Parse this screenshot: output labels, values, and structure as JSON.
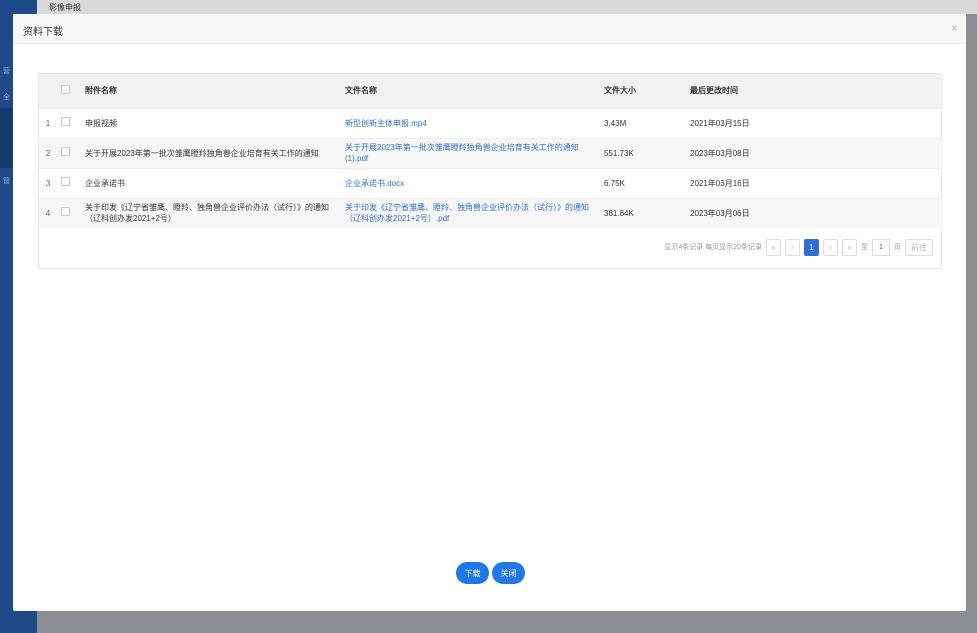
{
  "background": {
    "topbar_text": "影像申报",
    "sidebar_marks": [
      "营",
      "全",
      "管"
    ]
  },
  "modal": {
    "title": "资料下载",
    "close_glyph": "×"
  },
  "table": {
    "headers": {
      "attachment_name": "附件名称",
      "file_name": "文件名称",
      "file_size": "文件大小",
      "last_modified": "最后更改时间"
    },
    "rows": [
      {
        "index": "1",
        "attachment": "申报视频",
        "file": "新型创新主体申报.mp4",
        "size": "3.43M",
        "time": "2021年03月15日"
      },
      {
        "index": "2",
        "attachment": "关于开展2023年第一批次雏鹰瞪羚独角兽企业培育有关工作的通知",
        "file": "关于开展2023年第一批次雏鹰瞪羚独角兽企业培育有关工作的通知(1).pdf",
        "size": "551.73K",
        "time": "2023年03月08日"
      },
      {
        "index": "3",
        "attachment": "企业承诺书",
        "file": "企业承诺书.docx",
        "size": "6.75K",
        "time": "2021年03月16日"
      },
      {
        "index": "4",
        "attachment": "关于印发《辽宁省雏鹰、瞪羚、独角兽企业评价办法（试行）》的通知（辽科创办发2021+2号）",
        "file": "关于印发《辽宁省雏鹰、瞪羚、独角兽企业评价办法（试行）》的通知（辽科创办发2021+2号）.pdf",
        "size": "381.84K",
        "time": "2023年03月06日"
      }
    ]
  },
  "pagination": {
    "summary": "显示4条记录 每页显示20条记录",
    "first": "«",
    "prev": "‹",
    "current_page": "1",
    "next": "›",
    "last": "»",
    "goto_prefix": "至",
    "goto_value": "1",
    "goto_suffix": "页",
    "go_label": "前往"
  },
  "footer": {
    "download_label": "下载",
    "close_label": "关闭"
  }
}
